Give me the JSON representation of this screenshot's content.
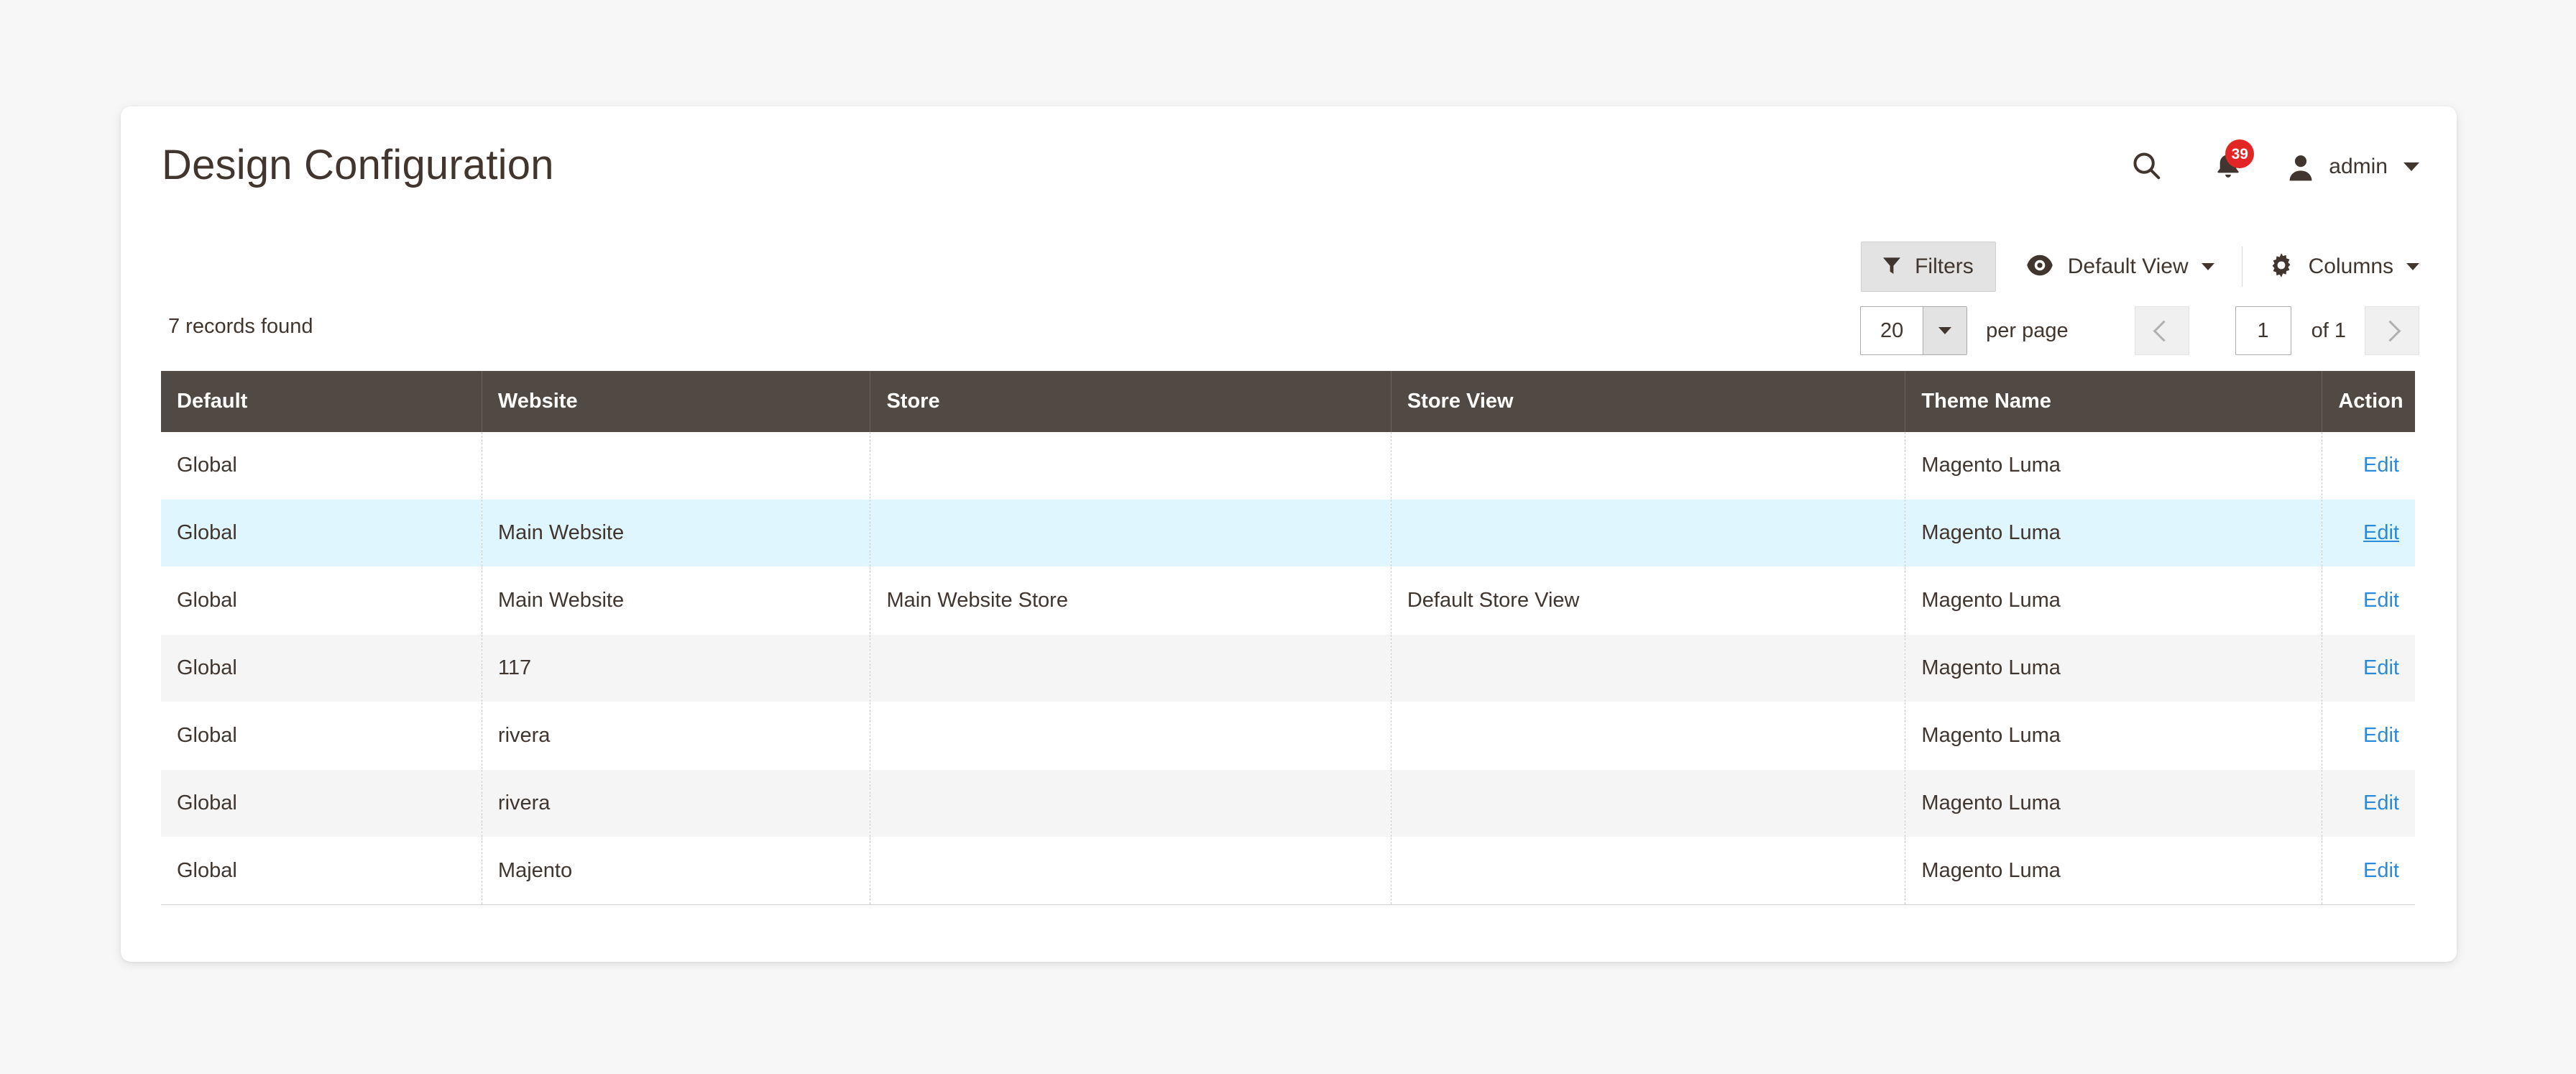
{
  "header": {
    "title": "Design Configuration",
    "search_icon": "search-icon",
    "notifications_icon": "bell-icon",
    "notifications_count": "39",
    "user_icon": "user-avatar-icon",
    "user_name": "admin",
    "user_caret_icon": "chevron-down-icon"
  },
  "toolbar": {
    "filters_label": "Filters",
    "filters_icon": "funnel-icon",
    "view_label": "Default View",
    "view_icon": "eye-icon",
    "view_caret_icon": "chevron-down-icon",
    "columns_label": "Columns",
    "columns_icon": "gear-icon",
    "columns_caret_icon": "chevron-down-icon"
  },
  "grid_meta": {
    "records_found": "7 records found"
  },
  "pager": {
    "per_page_value": "20",
    "per_page_caret_icon": "chevron-down-icon",
    "per_page_label": "per page",
    "prev_icon": "chevron-left-icon",
    "next_icon": "chevron-right-icon",
    "current_page": "1",
    "of_pages": "of 1"
  },
  "table": {
    "columns": [
      "Default",
      "Website",
      "Store",
      "Store View",
      "Theme Name",
      "Action"
    ],
    "rows": [
      {
        "default": "Global",
        "website": "",
        "store": "",
        "store_view": "",
        "theme_name": "Magento Luma",
        "action": "Edit",
        "state": "odd"
      },
      {
        "default": "Global",
        "website": "Main Website",
        "store": "",
        "store_view": "",
        "theme_name": "Magento Luma",
        "action": "Edit",
        "state": "hovered"
      },
      {
        "default": "Global",
        "website": "Main Website",
        "store": "Main Website Store",
        "store_view": "Default Store View",
        "theme_name": "Magento Luma",
        "action": "Edit",
        "state": "odd"
      },
      {
        "default": "Global",
        "website": "117",
        "store": "",
        "store_view": "",
        "theme_name": "Magento Luma",
        "action": "Edit",
        "state": "even"
      },
      {
        "default": "Global",
        "website": "rivera",
        "store": "",
        "store_view": "",
        "theme_name": "Magento Luma",
        "action": "Edit",
        "state": "odd"
      },
      {
        "default": "Global",
        "website": "rivera",
        "store": "",
        "store_view": "",
        "theme_name": "Magento Luma",
        "action": "Edit",
        "state": "even"
      },
      {
        "default": "Global",
        "website": "Majento",
        "store": "",
        "store_view": "",
        "theme_name": "Magento Luma",
        "action": "Edit",
        "state": "odd"
      }
    ]
  },
  "colors": {
    "page_background": "#f7f7f7",
    "card_background": "#ffffff",
    "table_header": "#514943",
    "row_hover": "#e0f6fe",
    "row_stripe": "#f5f5f5",
    "link": "#2a8bdb",
    "badge": "#e22626",
    "text": "#41362f"
  }
}
